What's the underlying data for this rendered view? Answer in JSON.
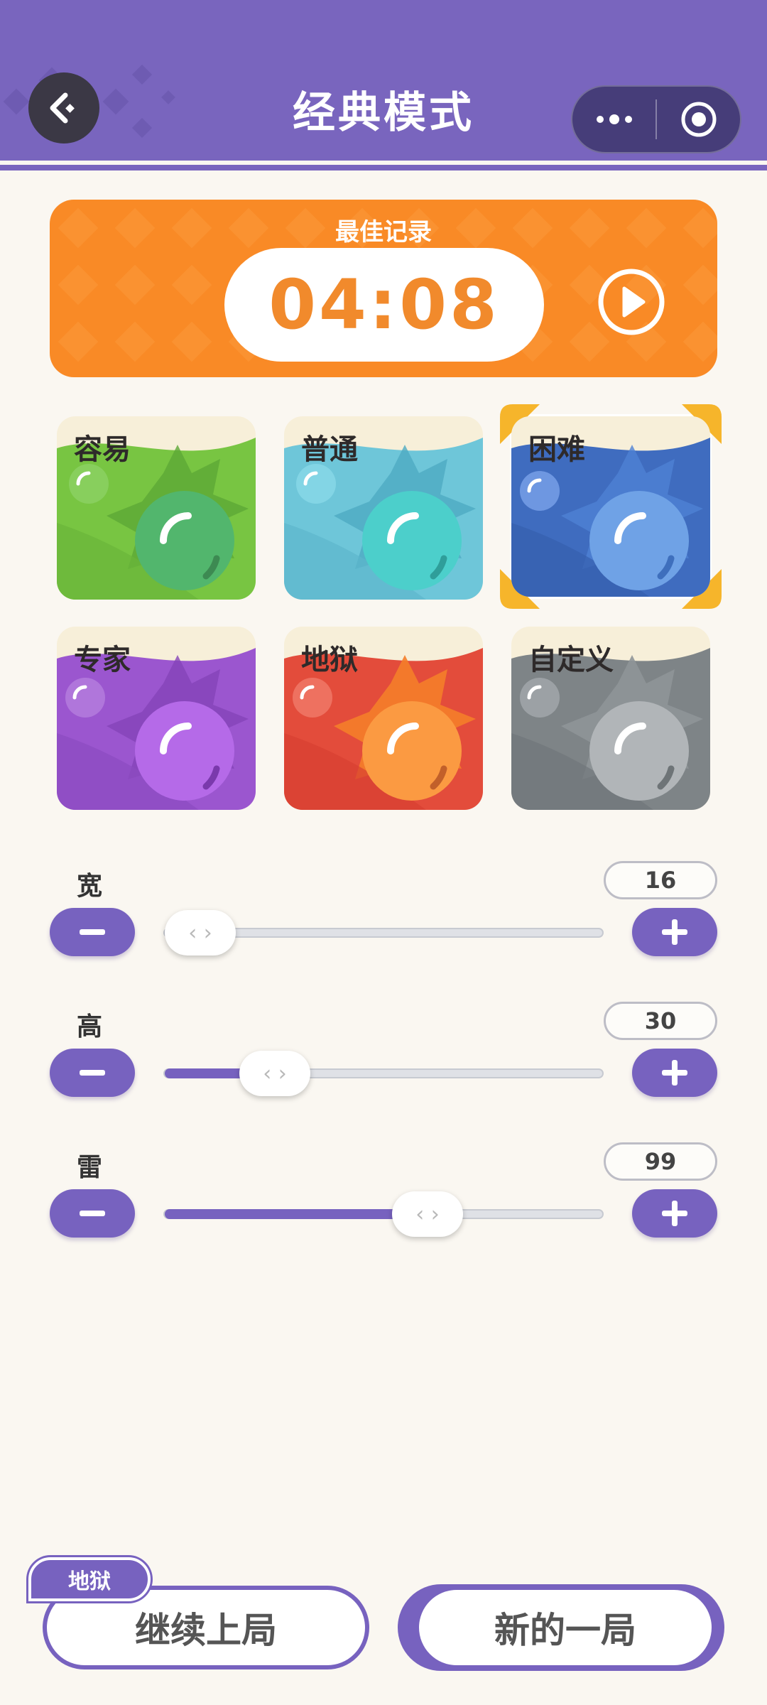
{
  "header": {
    "title": "经典模式",
    "back_icon": "back-arrow-icon",
    "capsule_icons": [
      "more-icon",
      "target-icon"
    ]
  },
  "record": {
    "label": "最佳记录",
    "time": "04:08",
    "play_icon": "play-icon"
  },
  "difficulties": [
    {
      "label": "容易",
      "color": "#78c542",
      "selected": false
    },
    {
      "label": "普通",
      "color": "#6ec6d9",
      "selected": false
    },
    {
      "label": "困难",
      "color": "#3f6cbf",
      "selected": true
    },
    {
      "label": "专家",
      "color": "#9b56cf",
      "selected": false
    },
    {
      "label": "地狱",
      "color": "#e34c3b",
      "selected": false
    },
    {
      "label": "自定义",
      "color": "#7e8487",
      "selected": false
    }
  ],
  "params": [
    {
      "label": "宽",
      "value": "16",
      "level": 0.0
    },
    {
      "label": "高",
      "value": "30",
      "level": 0.17
    },
    {
      "label": "雷",
      "value": "99",
      "level": 0.52
    }
  ],
  "buttons": {
    "continue_label": "继续上局",
    "continue_tag": "地狱",
    "new_label": "新的一局",
    "minus_icon": "minus-icon",
    "plus_icon": "plus-icon"
  },
  "colors": {
    "header": "#7965be",
    "accent": "#7762bf",
    "record": "#f98a26",
    "select_frame": "#f6b52b"
  }
}
